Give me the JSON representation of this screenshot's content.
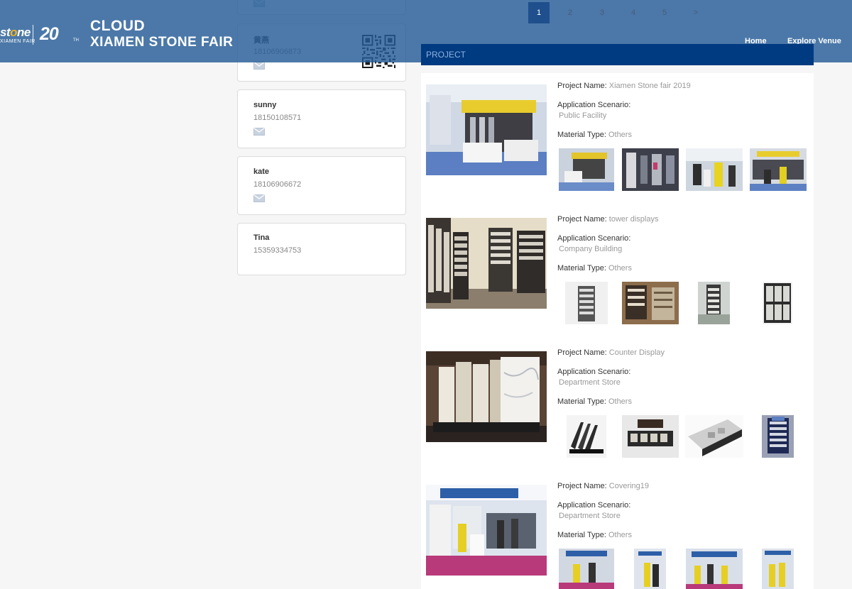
{
  "header": {
    "logo": {
      "stone_text": "stone",
      "fair_text": "XIAMEN FAIR",
      "anniversary": "20",
      "anniversary_suffix": "TH",
      "title_top": "CLOUD",
      "title_bottom": "XIAMEN STONE FAIR"
    },
    "nav": [
      "Home",
      "Explore Venue"
    ]
  },
  "pagination": {
    "pages": [
      "1",
      "2",
      "3",
      "4",
      "5"
    ],
    "next": ">",
    "active_page": "1"
  },
  "contacts": [
    {
      "name": "",
      "phone": ""
    },
    {
      "name": "黄燕",
      "phone": "18106906873"
    },
    {
      "name": "sunny",
      "phone": "18150108571"
    },
    {
      "name": "kate",
      "phone": "18106906672"
    },
    {
      "name": "Tina",
      "phone": "15359334753"
    }
  ],
  "project_section": {
    "title": "PROJECT",
    "labels": {
      "name": "Project Name:",
      "scenario": "Application Scenario:",
      "material": "Material Type:"
    },
    "projects": [
      {
        "name": "Xiamen Stone fair 2019",
        "scenario": "Public Facility",
        "material": "Others"
      },
      {
        "name": "tower displays",
        "scenario": "Company Building",
        "material": "Others"
      },
      {
        "name": "Counter Display",
        "scenario": "Department Store",
        "material": "Others"
      },
      {
        "name": "Covering19",
        "scenario": "Department Store",
        "material": "Others"
      }
    ]
  },
  "colors": {
    "header_bg": "#245c96",
    "project_bar": "#003a80",
    "active_page": "#1f4f8c",
    "logo_accent": "#f3b423"
  },
  "icons": {
    "contact": "envelope-icon",
    "qr": "qr-code-icon"
  }
}
